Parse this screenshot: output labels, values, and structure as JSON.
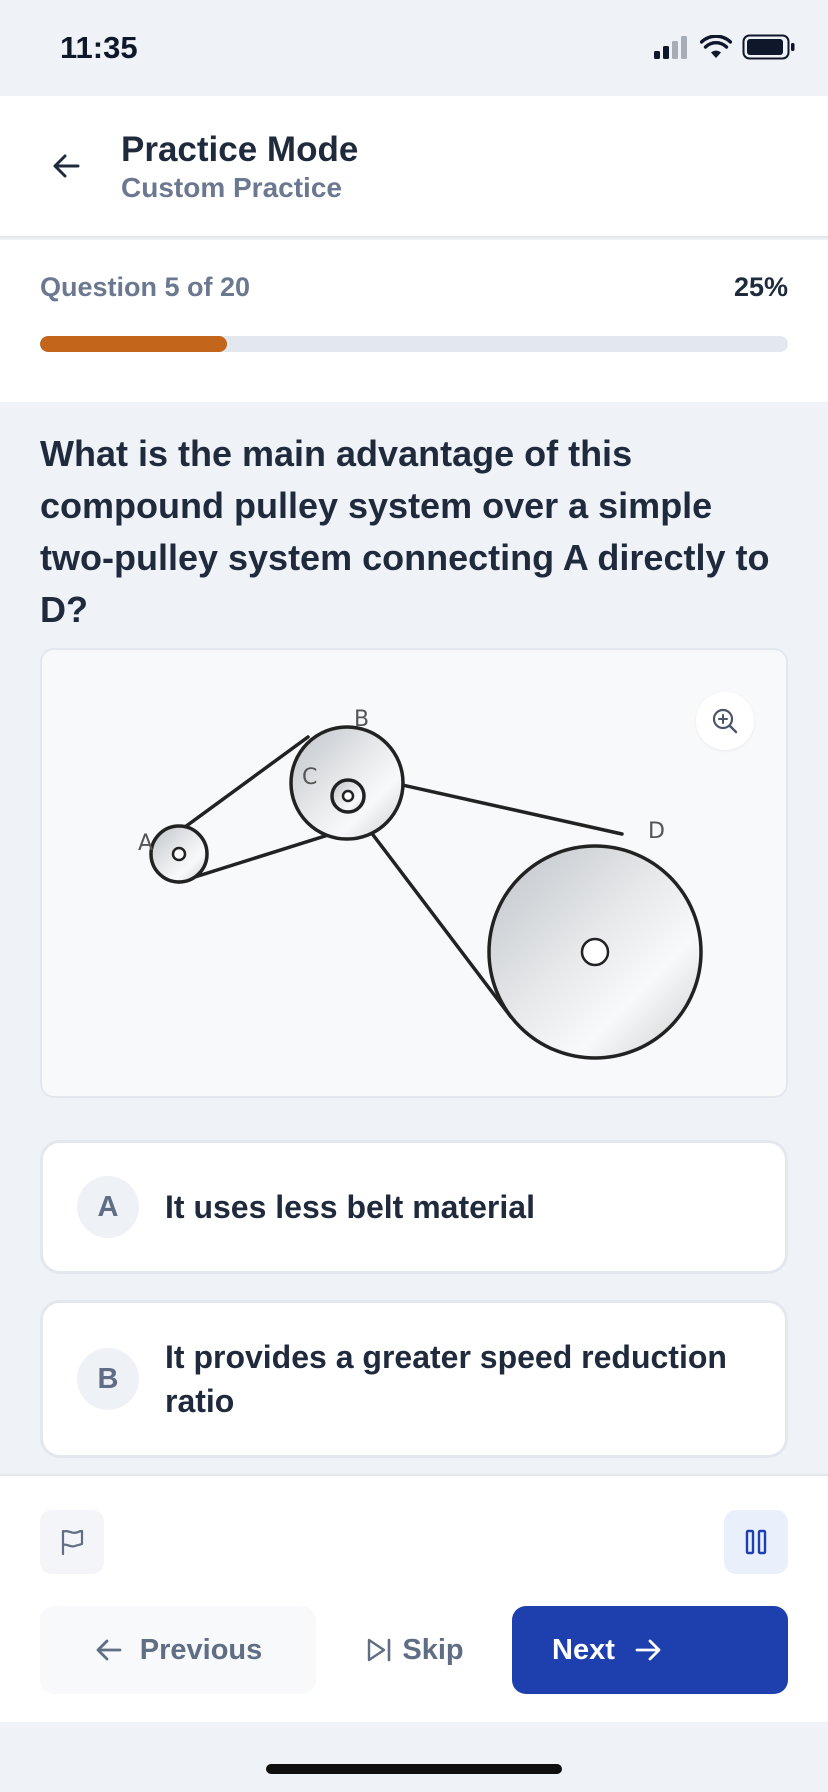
{
  "status_bar": {
    "time": "11:35"
  },
  "header": {
    "title": "Practice Mode",
    "subtitle": "Custom Practice"
  },
  "progress": {
    "label": "Question 5 of 20",
    "percent_text": "25%",
    "fraction": 0.25
  },
  "question": {
    "text": "What is the main advantage of this compound pulley system over a simple two-pulley system connecting A directly to D?"
  },
  "diagram": {
    "labels": {
      "a": "A",
      "b": "B",
      "c": "C",
      "d": "D"
    }
  },
  "options": [
    {
      "letter": "A",
      "text": "It uses less belt material"
    },
    {
      "letter": "B",
      "text": "It provides a greater speed reduction ratio"
    }
  ],
  "nav": {
    "previous_label": "Previous",
    "skip_label": "Skip",
    "next_label": "Next"
  },
  "colors": {
    "accent": "#1e40af",
    "progress": "#c4651c"
  },
  "icons": {
    "back": "arrow-left-icon",
    "zoom": "zoom-in-icon",
    "flag": "flag-icon",
    "pause": "pause-icon",
    "previous": "arrow-left-icon",
    "skip": "skip-forward-icon",
    "next": "arrow-right-icon"
  }
}
